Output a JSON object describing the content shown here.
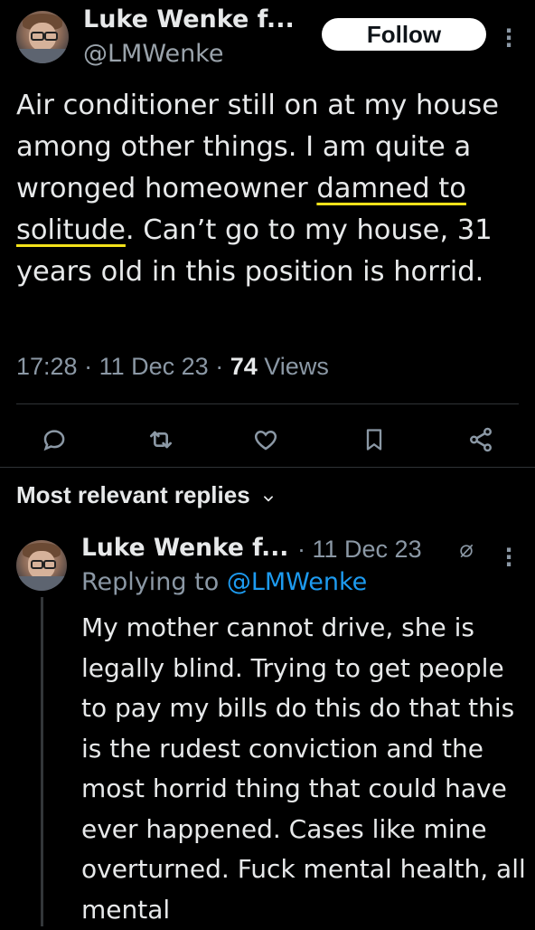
{
  "tweet": {
    "author_name": "Luke Wenke f...",
    "author_handle": "@LMWenke",
    "follow_label": "Follow",
    "text_part1": "Air conditioner still on at my house among other things.  I am quite a wronged homeowner ",
    "text_underlined": "damned to solitude",
    "text_part2": ".  Can’t go to my house, 31 years old in this position is horrid.",
    "time": "17:28",
    "date": "11 Dec 23",
    "views_count": "74",
    "views_label": "Views",
    "separator": "·"
  },
  "actions": [
    {
      "name": "reply-icon"
    },
    {
      "name": "retweet-icon"
    },
    {
      "name": "like-icon"
    },
    {
      "name": "bookmark-icon"
    },
    {
      "name": "share-icon"
    }
  ],
  "replies_section": {
    "title": "Most relevant replies",
    "chevron": "⌄"
  },
  "reply": {
    "author_name": "Luke Wenke f...",
    "separator": "·",
    "date": "11 Dec 23",
    "replying_to_label": "Replying to",
    "replying_to_handle": "@LMWenke",
    "text": "My mother cannot drive, she is legally blind.  Trying to get people to pay my bills do this do that this is the rudest conviction and the most horrid thing that could have ever happened. Cases like mine overturned. Fuck mental health, all mental"
  },
  "colors": {
    "background": "#000000",
    "text": "#e7e9ea",
    "muted": "#8b98a5",
    "link": "#1d9bf0",
    "underline_highlight": "#f3e21a",
    "follow_button_bg": "#ffffff"
  }
}
